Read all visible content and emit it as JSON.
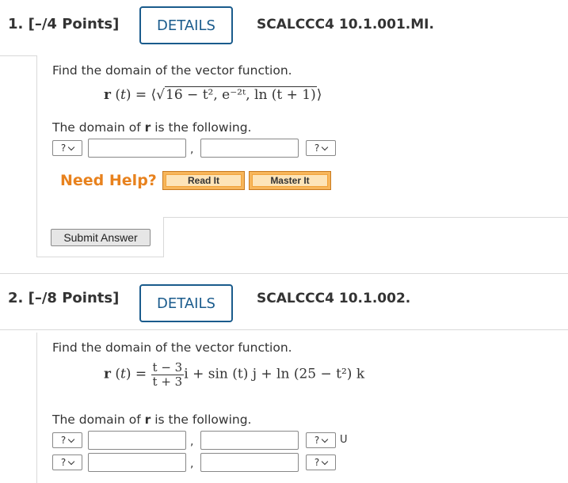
{
  "details_label": "DETAILS",
  "questions": [
    {
      "number": "1. [–/4 Points]",
      "code": "SCALCCC4 10.1.001.MI.",
      "prompt": "Find the domain of the vector function.",
      "formula_lhs": "r (t) = ",
      "formula_rhs": "16 − t², e⁻²ᵗ, ln (t + 1)",
      "domain_sentence_start": "The domain of ",
      "domain_sentence_r": "r",
      "domain_sentence_end": " is the following.",
      "select_placeholder": "?",
      "comma": ",",
      "need_help": "Need Help?",
      "read_it": "Read It",
      "master_it": "Master It",
      "submit": "Submit Answer"
    },
    {
      "number": "2. [–/8 Points]",
      "code": "SCALCCC4 10.1.002.",
      "prompt": "Find the domain of the vector function.",
      "formula_lhs": "r (t) = ",
      "frac_num": "t − 3",
      "frac_den": "t + 3",
      "formula_rest": "i + sin (t) j + ln (25 − t²) k",
      "domain_sentence_start": "The domain of ",
      "domain_sentence_r": "r",
      "domain_sentence_end": " is the following.",
      "select_placeholder": "?",
      "comma": ",",
      "union": "U"
    }
  ],
  "colors": {
    "accent": "#1a5b8c",
    "need_help": "#e8821e",
    "help_button": "#f7b65b"
  }
}
